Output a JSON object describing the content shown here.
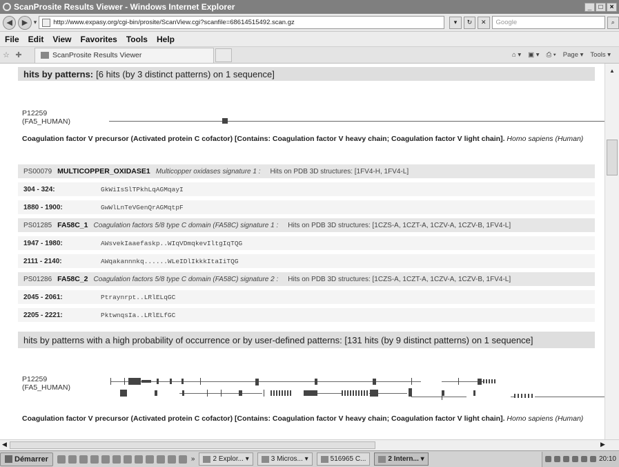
{
  "window": {
    "title": "ScanProsite Results Viewer - Windows Internet Explorer",
    "controls": [
      "_",
      "□",
      "×"
    ]
  },
  "address_bar": {
    "url": "http://www.expasy.org/cgi-bin/prosite/ScanView.cgi?scanfile=68614515492.scan.gz",
    "search_placeholder": "Google"
  },
  "menu": [
    "File",
    "Edit",
    "View",
    "Favorites",
    "Tools",
    "Help"
  ],
  "tab": {
    "label": "ScanProsite Results Viewer",
    "toolbar": [
      "Page ▾",
      "Tools ▾"
    ]
  },
  "section1": {
    "heading_bold": "hits by patterns:",
    "heading_rest": "[6 hits (by 3 distinct patterns) on 1 sequence]",
    "seq_id": "P12259",
    "seq_name": "(FA5_HUMAN)",
    "desc_bold": "Coagulation factor V precursor (Activated protein C cofactor) [Contains: Coagulation factor V heavy chain; Coagulation factor V light chain].",
    "desc_species": "Homo sapiens (Human)",
    "patterns": [
      {
        "acc": "PS00079",
        "name": "MULTICOPPER_OXIDASE1",
        "desc": "Multicopper oxidases signature 1 :",
        "pdb": "Hits on PDB 3D structures: [1FV4-H, 1FV4-L]",
        "hits": [
          {
            "range": "304 - 324:",
            "seq": "GkWiIsSlTPkhLqAGMqayI"
          },
          {
            "range": "1880 - 1900:",
            "seq": "GwWlLnTeVGenQrAGMqtpF"
          }
        ]
      },
      {
        "acc": "PS01285",
        "name": "FA58C_1",
        "desc": "Coagulation factors 5/8 type C domain (FA58C) signature 1 :",
        "pdb": "Hits on PDB 3D structures: [1CZS-A, 1CZT-A, 1CZV-A, 1CZV-B, 1FV4-L]",
        "hits": [
          {
            "range": "1947 - 1980:",
            "seq": "AWsvekIaaefaskp..WIqVDmqkevIltgIqTQG"
          },
          {
            "range": "2111 - 2140:",
            "seq": "AWqakannnkq......WLeIDlIkkkItaIiTQG"
          }
        ]
      },
      {
        "acc": "PS01286",
        "name": "FA58C_2",
        "desc": "Coagulation factors 5/8 type C domain (FA58C) signature 2 :",
        "pdb": "Hits on PDB 3D structures: [1CZS-A, 1CZT-A, 1CZV-A, 1CZV-B, 1FV4-L]",
        "hits": [
          {
            "range": "2045 - 2061:",
            "seq": "Ptraynrpt..LRlELqGC"
          },
          {
            "range": "2205 - 2221:",
            "seq": "PktwnqsIa..LRlELfGC"
          }
        ]
      }
    ]
  },
  "section2": {
    "heading": "hits by patterns with a high probability of occurrence or by user-defined patterns: [131 hits (by 9 distinct patterns) on 1 sequence]",
    "seq_id": "P12259",
    "seq_name": "(FA5_HUMAN)",
    "desc_bold": "Coagulation factor V precursor (Activated protein C cofactor) [Contains: Coagulation factor V heavy chain; Coagulation factor V light chain].",
    "desc_species": "Homo sapiens (Human)"
  },
  "taskbar": {
    "start": "Démarrer",
    "buttons": [
      "2 Explor... ▾",
      "3 Micros... ▾",
      "516965 C...",
      "2 Intern... ▾"
    ],
    "clock": "20:10"
  }
}
